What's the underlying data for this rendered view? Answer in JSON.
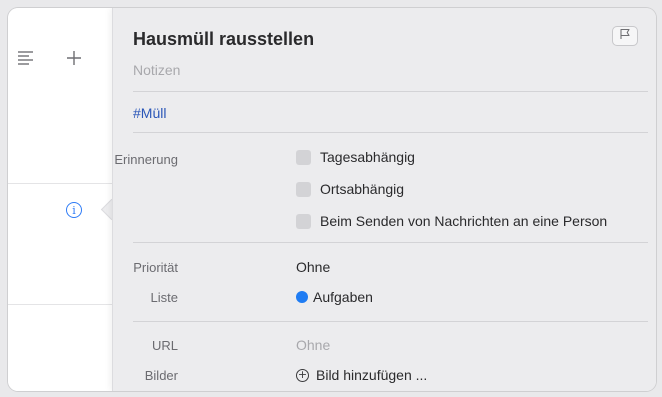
{
  "reminder": {
    "title": "Hausmüll rausstellen",
    "notes_placeholder": "Notizen",
    "tag": "#Müll"
  },
  "reminders": {
    "label": "Erinnerung",
    "options": [
      "Tagesabhängig",
      "Ortsabhängig",
      "Beim Senden von Nachrichten an eine Person"
    ]
  },
  "priority": {
    "label": "Priorität",
    "value": "Ohne"
  },
  "list": {
    "label": "Liste",
    "value": "Aufgaben",
    "color": "#1f7cf3"
  },
  "url": {
    "label": "URL",
    "placeholder": "Ohne"
  },
  "images": {
    "label": "Bilder",
    "add_label": "Bild hinzufügen ..."
  },
  "icons": {
    "sort": "list-icon",
    "add": "plus-icon",
    "info": "info-icon",
    "flag": "flag-icon"
  }
}
